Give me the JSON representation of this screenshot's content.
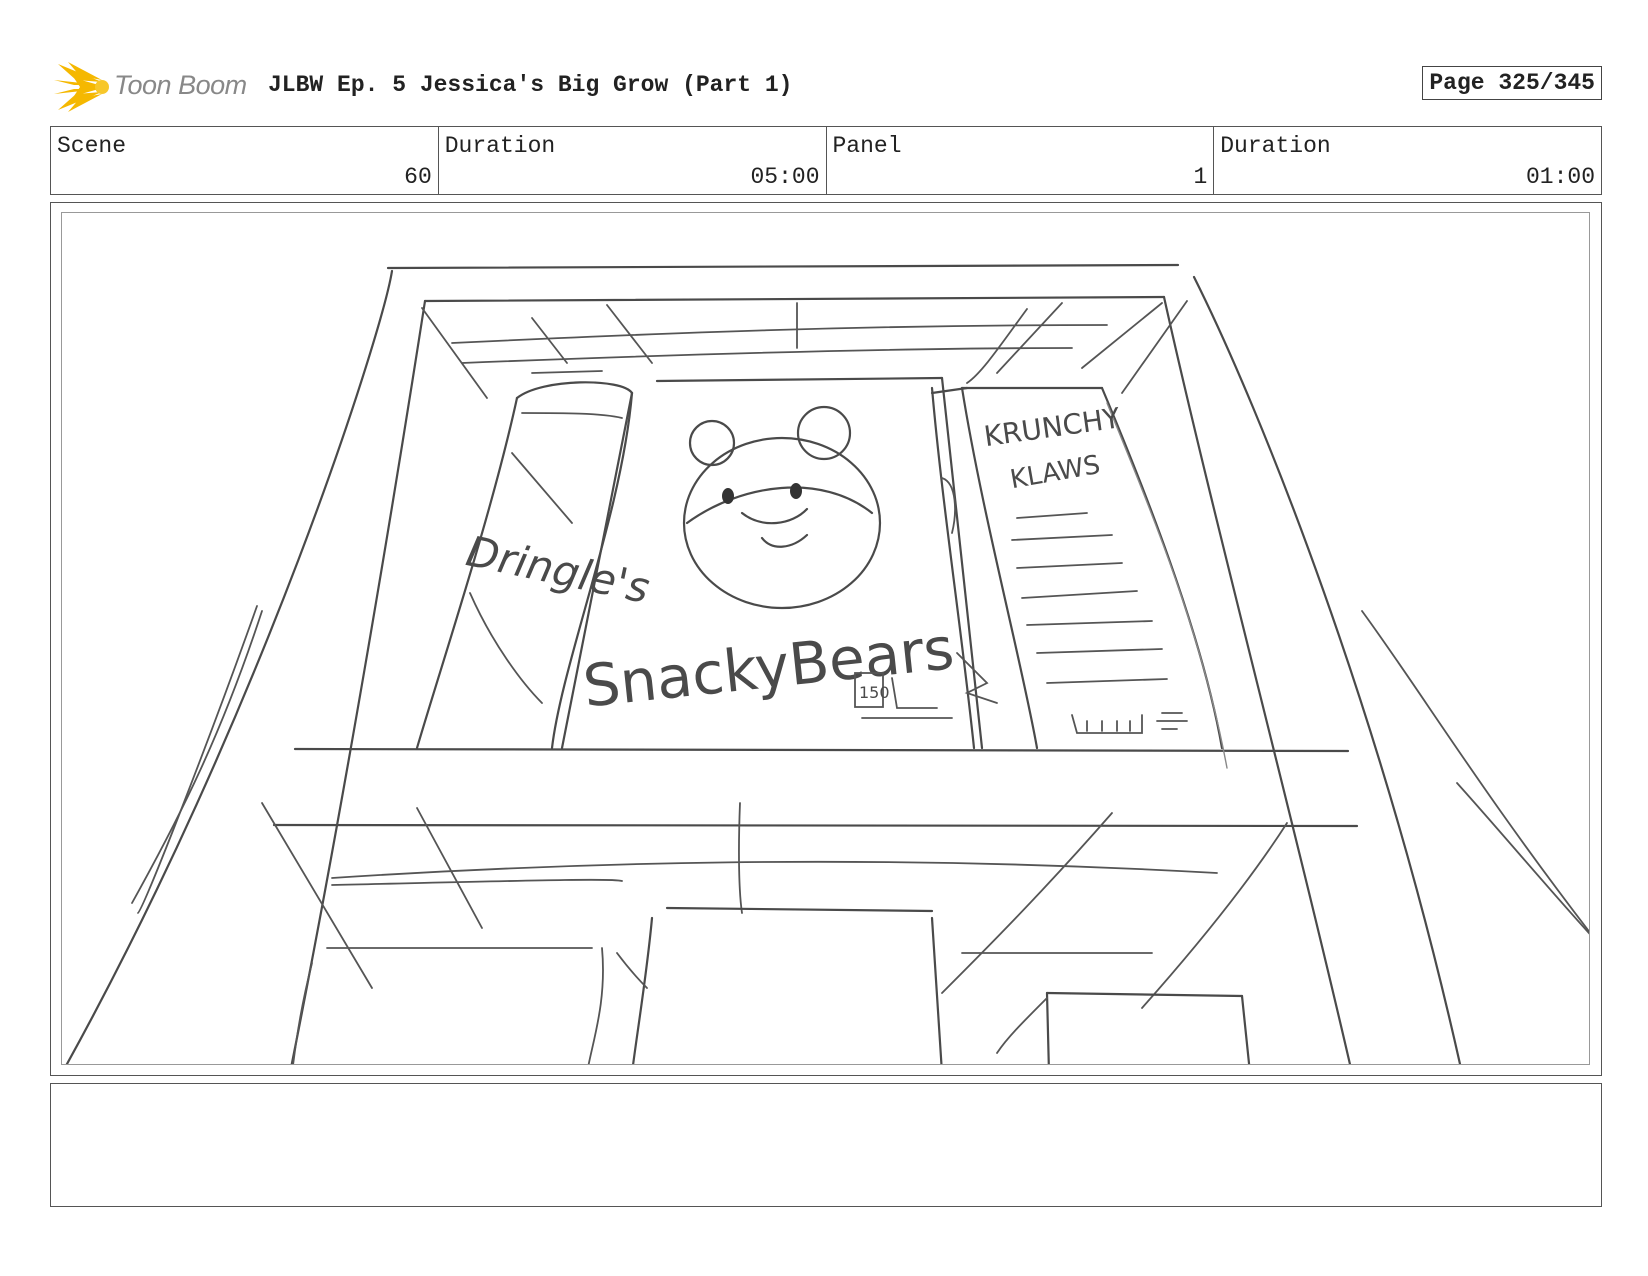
{
  "header": {
    "logo_text": "Toon Boom",
    "title": "JLBW Ep. 5 Jessica's Big Grow (Part 1)",
    "page": "Page 325/345"
  },
  "info": {
    "scene_label": "Scene",
    "scene_value": "60",
    "duration_label": "Duration",
    "duration_value": "05:00",
    "panel_label": "Panel",
    "panel_value": "1",
    "panel_duration_label": "Duration",
    "panel_duration_value": "01:00"
  },
  "sketch": {
    "box_left": "Dringle's",
    "box_center": "SnackyBears",
    "box_right_line1": "KRUNCHY",
    "box_right_line2": "KLAWS",
    "price_tag": "150"
  },
  "notes": {
    "text": ""
  }
}
